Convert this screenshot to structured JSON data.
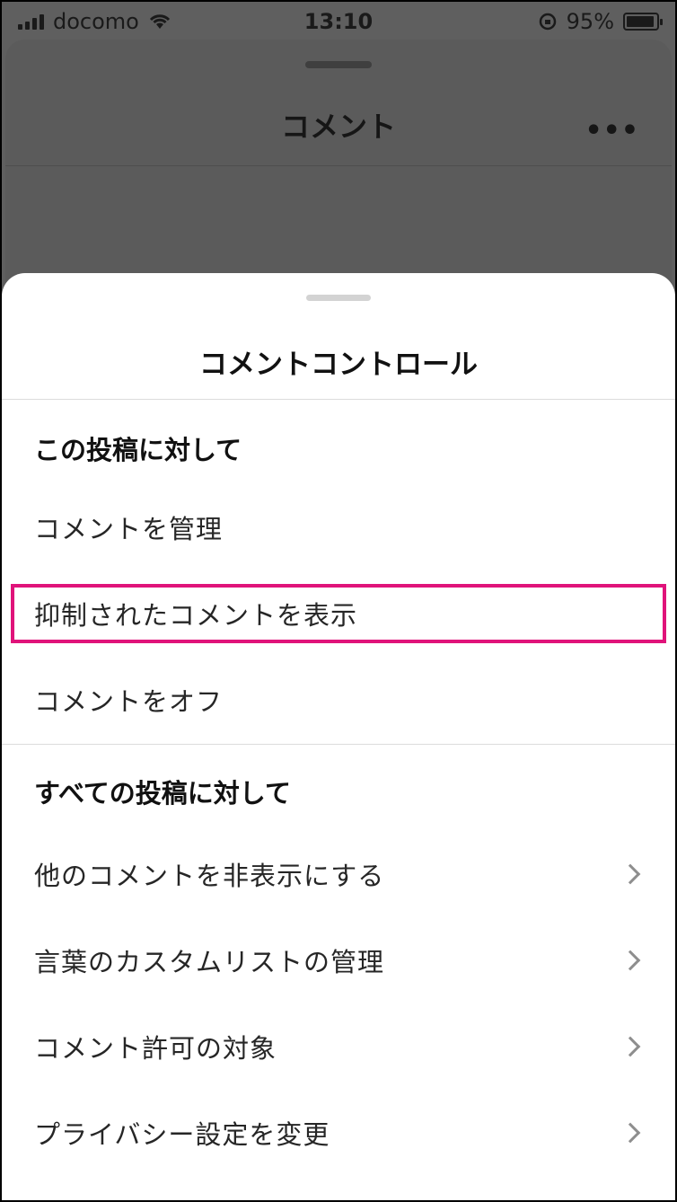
{
  "status_bar": {
    "carrier": "docomo",
    "time": "13:10",
    "battery": "95%",
    "battery_level": 0.95
  },
  "background": {
    "title": "コメント",
    "more": "•••"
  },
  "sheet": {
    "title": "コメントコントロール",
    "sections": [
      {
        "header": "この投稿に対して",
        "items": [
          {
            "label": "コメントを管理"
          },
          {
            "label": "抑制されたコメントを表示"
          },
          {
            "label": "コメントをオフ"
          }
        ]
      },
      {
        "header": "すべての投稿に対して",
        "items": [
          {
            "label": "他のコメントを非表示にする"
          },
          {
            "label": "言葉のカスタムリストの管理"
          },
          {
            "label": "コメント許可の対象"
          },
          {
            "label": "プライバシー設定を変更"
          }
        ]
      }
    ]
  },
  "colors": {
    "highlight": "#e0137a",
    "overlay": "#5f5f5f"
  }
}
